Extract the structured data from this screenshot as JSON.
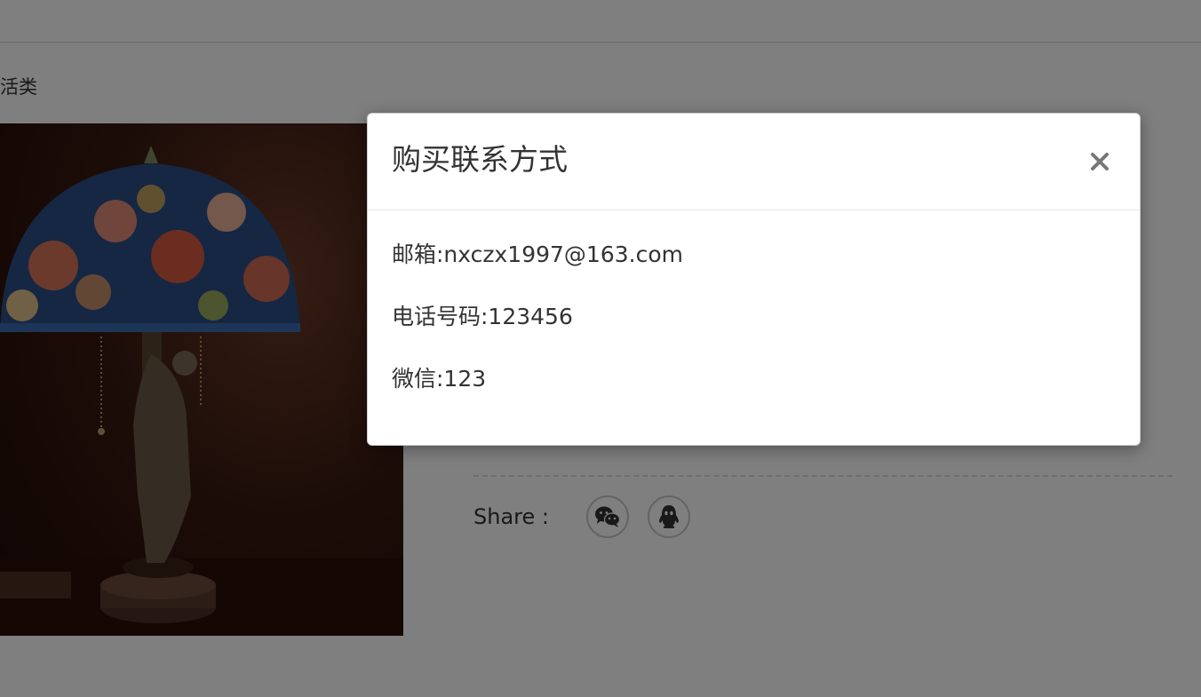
{
  "page": {
    "breadcrumb_tail": "活类",
    "share_label": "Share :",
    "share_buttons": [
      {
        "name": "wechat",
        "icon": "wechat-icon"
      },
      {
        "name": "qq",
        "icon": "qq-icon"
      }
    ]
  },
  "modal": {
    "title": "购买联系方式",
    "close_icon": "close-icon",
    "lines": [
      {
        "label": "邮箱",
        "value": "nxczx1997@163.com",
        "text": "邮箱:nxczx1997@163.com"
      },
      {
        "label": "电话号码",
        "value": "123456",
        "text": "电话号码:123456"
      },
      {
        "label": "微信",
        "value": "123",
        "text": "微信:123"
      }
    ]
  },
  "colors": {
    "backdrop": "rgba(0,0,0,0.5)",
    "modal_bg": "#ffffff",
    "text": "#333333"
  }
}
